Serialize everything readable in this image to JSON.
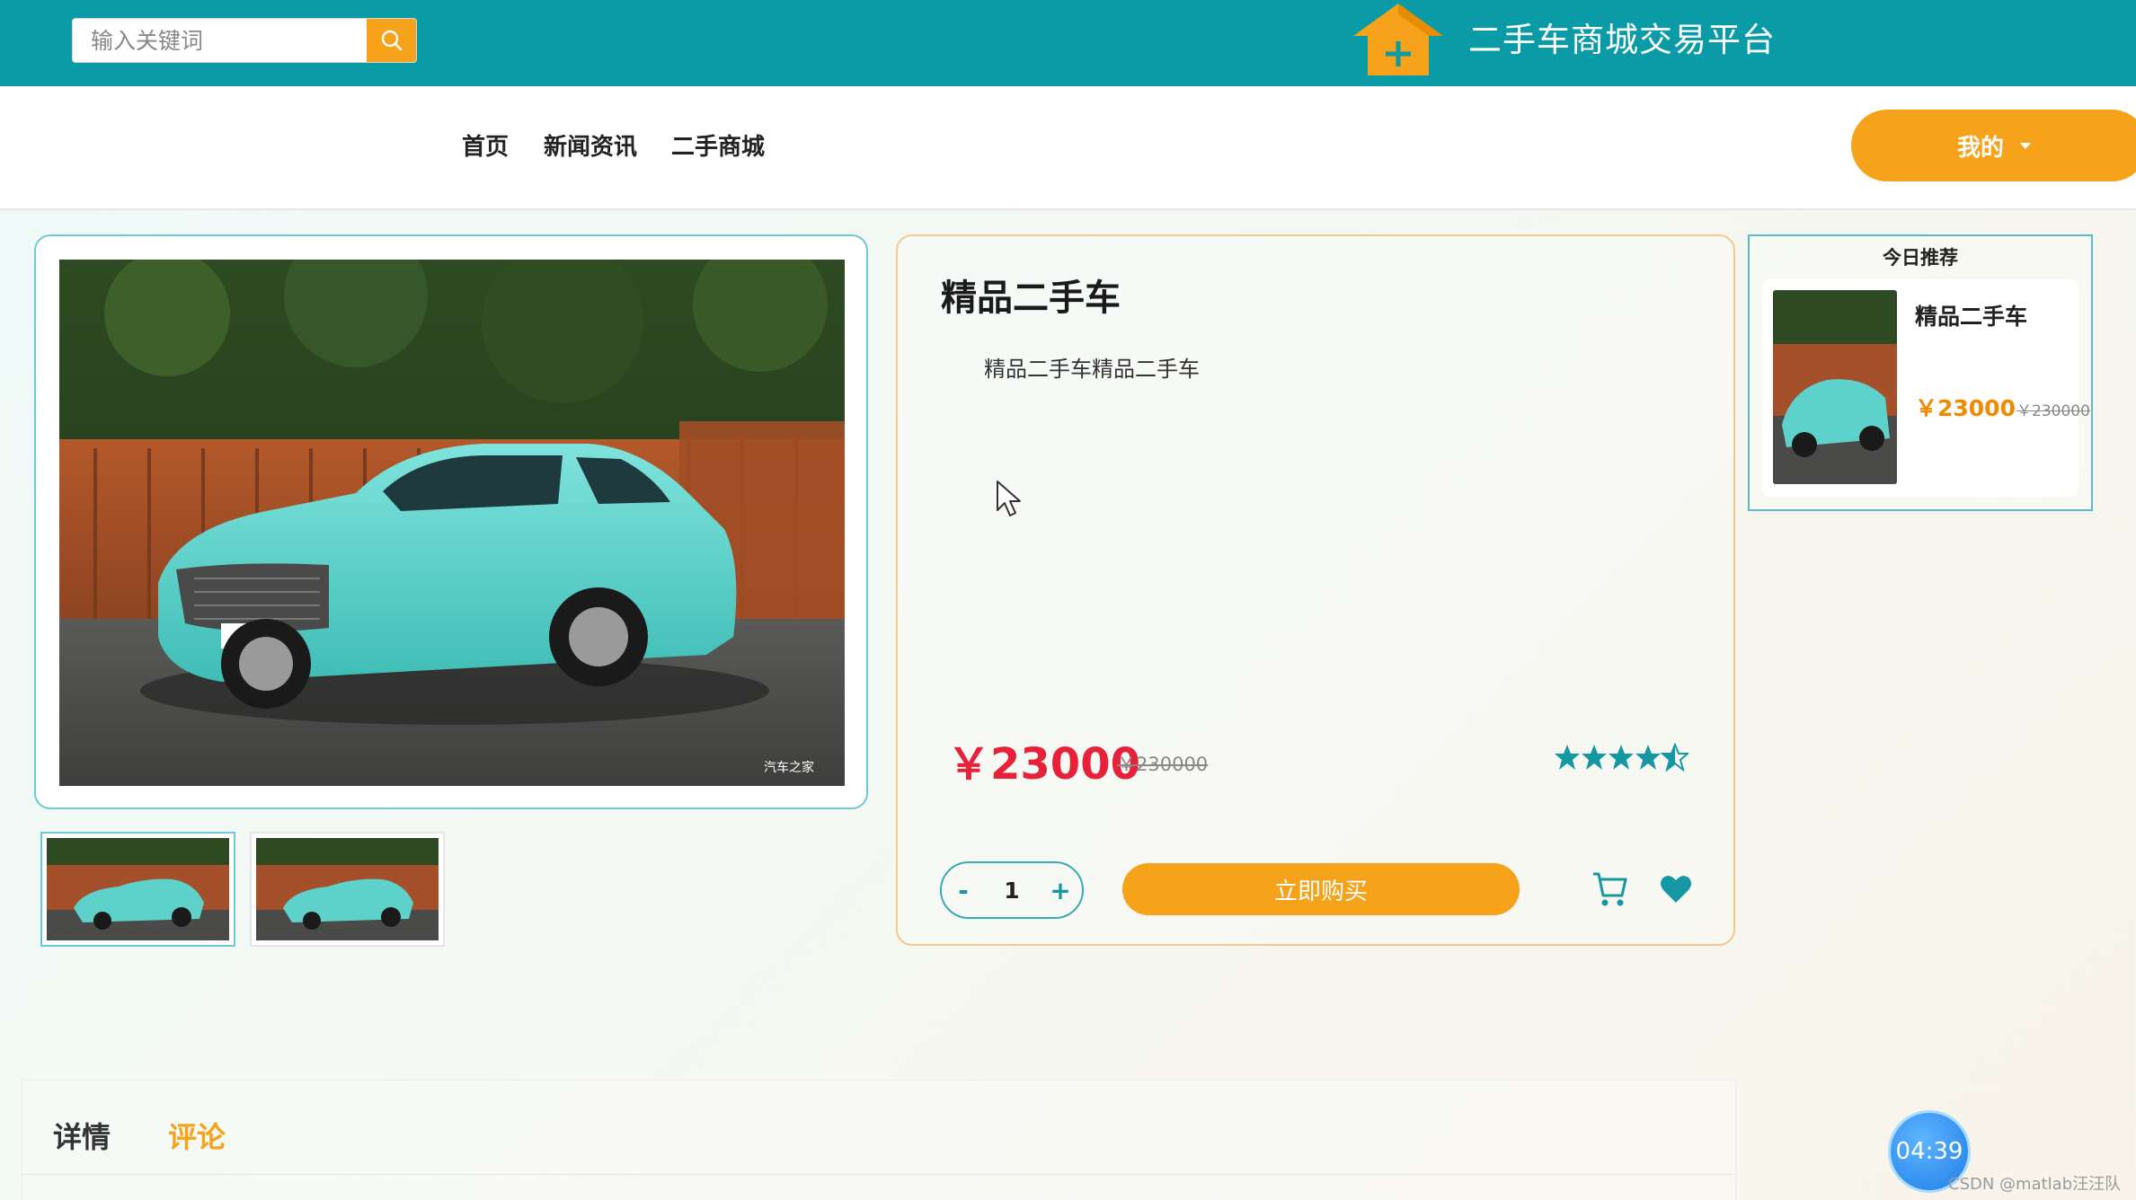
{
  "header": {
    "search_placeholder": "输入关键词",
    "search_icon": "search-icon",
    "logo_icon": "house-plus-icon",
    "site_title": "二手车商城交易平台",
    "bar_color": "#0a9ba6"
  },
  "nav": {
    "items": [
      "首页",
      "新闻资讯",
      "二手商城"
    ],
    "mine_label": "我的",
    "mine_icon": "caret-down-icon"
  },
  "product": {
    "title": "精品二手车",
    "description": "精品二手车精品二手车",
    "price": "￥23000",
    "original_price": "￥230000",
    "rating": 4.5,
    "quantity": {
      "minus": "-",
      "value": "1",
      "plus": "+"
    },
    "buy_label": "立即购买",
    "cart_icon": "shopping-cart-icon",
    "favorite_icon": "heart-icon",
    "image_watermark": "汽车之家",
    "thumbnails": [
      "thumbnail-1",
      "thumbnail-2"
    ]
  },
  "recommend": {
    "heading": "今日推荐",
    "item": {
      "title": "精品二手车",
      "price": "￥23000",
      "original_price": "￥230000"
    }
  },
  "tabs": {
    "detail": "详情",
    "comment": "评论",
    "active": "评论"
  },
  "overlay": {
    "timer": "04:39",
    "watermark": "CSDN @matlab汪汪队"
  },
  "colors": {
    "accent_orange": "#f7a21b",
    "teal": "#0a9ba6",
    "price_red": "#e8213a"
  }
}
